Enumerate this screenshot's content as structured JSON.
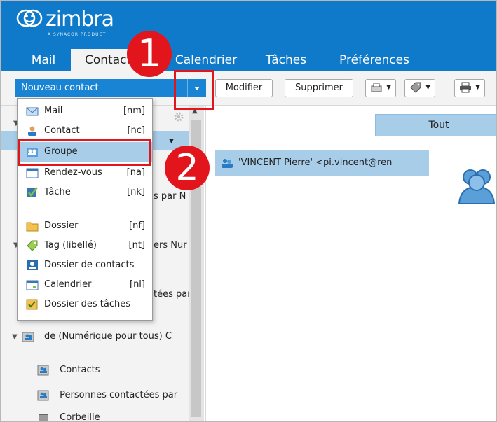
{
  "app": {
    "brand": "zimbra",
    "brand_tagline": "A SYNACOR PRODUCT"
  },
  "tabs": [
    {
      "label": "Mail",
      "active": false
    },
    {
      "label": "Contacts",
      "active": true
    },
    {
      "label": "Calendrier",
      "active": false
    },
    {
      "label": "Tâches",
      "active": false
    },
    {
      "label": "Préférences",
      "active": false
    }
  ],
  "toolbar": {
    "new_label": "Nouveau contact",
    "edit_label": "Modifier",
    "delete_label": "Supprimer",
    "tout_label": "Tout"
  },
  "menu": {
    "items": [
      {
        "label": "Mail",
        "shortcut": "[nm]",
        "icon": "mail-icon"
      },
      {
        "label": "Contact",
        "shortcut": "[nc]",
        "icon": "contact-icon"
      },
      {
        "label": "Groupe",
        "shortcut": "",
        "icon": "group-icon",
        "highlighted": true
      },
      {
        "label": "Rendez-vous",
        "shortcut": "[na]",
        "icon": "appointment-icon"
      },
      {
        "label": "Tâche",
        "shortcut": "[nk]",
        "icon": "task-icon"
      },
      {
        "label": "Dossier",
        "shortcut": "[nf]",
        "icon": "folder-icon"
      },
      {
        "label": "Tag (libellé)",
        "shortcut": "[nt]",
        "icon": "tag-icon"
      },
      {
        "label": "Dossier de contacts",
        "shortcut": "",
        "icon": "contacts-folder-icon"
      },
      {
        "label": "Calendrier",
        "shortcut": "[nl]",
        "icon": "calendar-icon"
      },
      {
        "label": "Dossier des tâches",
        "shortcut": "",
        "icon": "tasks-folder-icon"
      }
    ]
  },
  "sidebar": {
    "peek_1": "s par N",
    "peek_2": "ers Nur",
    "peek_3": "tées par",
    "peek_4": "Corbeille",
    "shared_group": "de (Numérique pour tous) C",
    "items": [
      {
        "label": "Contacts"
      },
      {
        "label": "Personnes contactées par"
      },
      {
        "label": "Corbeille"
      }
    ]
  },
  "list": {
    "selected_contact": "'VINCENT Pierre' <pi.vincent@ren"
  },
  "annotations": {
    "step1": "1",
    "step2": "2"
  },
  "colors": {
    "header": "#0f7ac9",
    "selection": "#a7cde9",
    "primary_button": "#1a84d4",
    "annotation_red": "#e2141c"
  }
}
